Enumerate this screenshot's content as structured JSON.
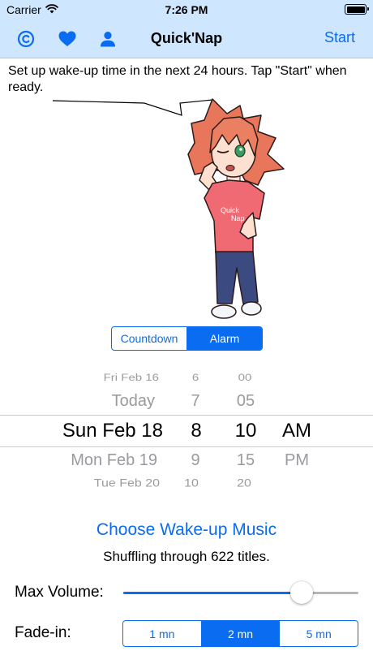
{
  "status_bar": {
    "carrier": "Carrier",
    "time": "7:26 PM"
  },
  "nav": {
    "title": "Quick'Nap",
    "start_label": "Start",
    "icons": [
      "copyright-icon",
      "heart-icon",
      "user-icon"
    ]
  },
  "instruction": "Set up wake-up time in the next 24 hours. Tap \"Start\" when ready.",
  "mode": {
    "options": [
      "Countdown",
      "Alarm"
    ],
    "selected": "Alarm"
  },
  "picker": {
    "days": [
      "Fri Feb 16",
      "Today",
      "Sun Feb 18",
      "Mon Feb 19",
      "Tue Feb 20"
    ],
    "hours": [
      "6",
      "7",
      "8",
      "9",
      "10"
    ],
    "minutes": [
      "00",
      "05",
      "10",
      "15",
      "20"
    ],
    "ampm": [
      "AM",
      "PM"
    ],
    "selected": {
      "day": "Sun Feb 18",
      "hour": "8",
      "minute": "10",
      "ampm": "AM"
    }
  },
  "music": {
    "link_label": "Choose Wake-up Music",
    "status": "Shuffling through 622 titles."
  },
  "volume": {
    "label": "Max Volume:",
    "level": 0.76
  },
  "fade_in": {
    "label": "Fade-in:",
    "options": [
      "1 mn",
      "2 mn",
      "5 mn"
    ],
    "selected": "2 mn"
  },
  "colors": {
    "accent": "#0a6cf0",
    "bar_background": "#cfe6ff"
  }
}
